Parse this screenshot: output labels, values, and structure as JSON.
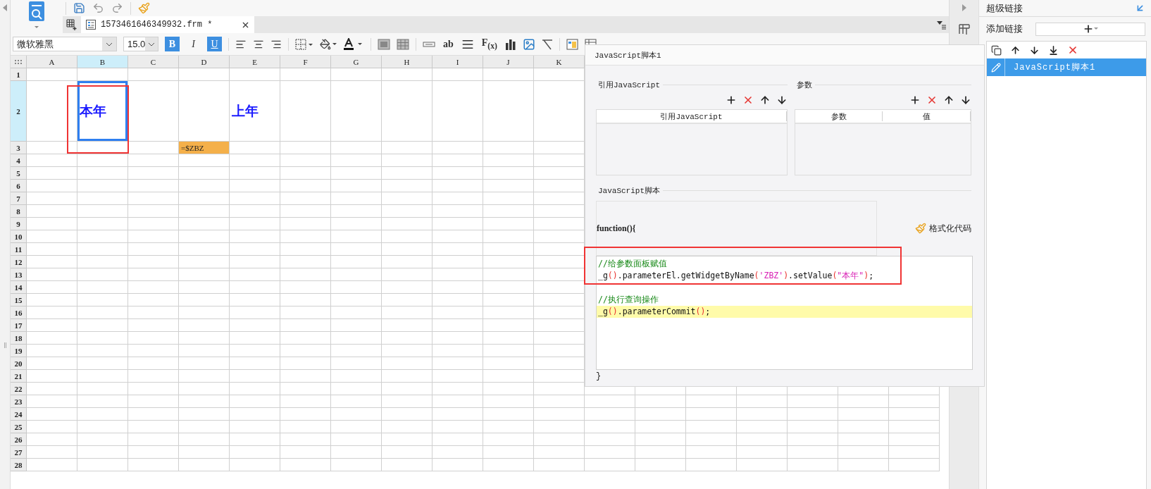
{
  "file_tab": {
    "title": "1573461646349932.frm *",
    "selected": true
  },
  "format_bar": {
    "font": "微软雅黑",
    "size": "15.0",
    "bold": {
      "label": "B",
      "on": true
    },
    "italic": {
      "label": "I",
      "on": false
    },
    "underline": {
      "label": "U",
      "on": true
    },
    "text_tools": [
      "ab",
      "F$_{(x)}$"
    ]
  },
  "sheet": {
    "columns": [
      {
        "label": "A",
        "selected": false
      },
      {
        "label": "B",
        "selected": true
      },
      {
        "label": "C",
        "selected": false
      },
      {
        "label": "D",
        "selected": false
      },
      {
        "label": "E",
        "selected": false
      },
      {
        "label": "F",
        "selected": false
      },
      {
        "label": "G",
        "selected": false
      },
      {
        "label": "H",
        "selected": false
      },
      {
        "label": "I",
        "selected": false
      },
      {
        "label": "J",
        "selected": false
      },
      {
        "label": "K",
        "selected": false
      }
    ],
    "rows": [
      {
        "label": "1",
        "selected": false
      },
      {
        "label": "2",
        "selected": true,
        "cells": [
          null,
          {
            "text": "本年",
            "kind": "title",
            "selected": true
          },
          null,
          null,
          {
            "text": "上年",
            "kind": "title",
            "selected": false
          }
        ]
      },
      {
        "label": "3",
        "selected": false,
        "cells": [
          null,
          null,
          null,
          {
            "text": "=$ZBZ",
            "kind": "formula",
            "selected": false
          }
        ]
      },
      {
        "label": "4",
        "selected": false
      },
      {
        "label": "5",
        "selected": false
      },
      {
        "label": "6",
        "selected": false
      },
      {
        "label": "7",
        "selected": false
      },
      {
        "label": "8",
        "selected": false
      },
      {
        "label": "9",
        "selected": false
      },
      {
        "label": "10",
        "selected": false
      },
      {
        "label": "11",
        "selected": false
      },
      {
        "label": "12",
        "selected": false
      },
      {
        "label": "13",
        "selected": false
      },
      {
        "label": "14",
        "selected": false
      },
      {
        "label": "15",
        "selected": false
      },
      {
        "label": "16",
        "selected": false
      },
      {
        "label": "17",
        "selected": false
      },
      {
        "label": "18",
        "selected": false
      },
      {
        "label": "19",
        "selected": false
      },
      {
        "label": "20",
        "selected": false
      },
      {
        "label": "21",
        "selected": false
      },
      {
        "label": "22",
        "selected": false
      },
      {
        "label": "23",
        "selected": false
      },
      {
        "label": "24",
        "selected": false
      },
      {
        "label": "25",
        "selected": false
      },
      {
        "label": "26",
        "selected": false
      },
      {
        "label": "27",
        "selected": false
      },
      {
        "label": "28",
        "selected": false
      }
    ]
  },
  "dialog": {
    "title": "JavaScript脚本1",
    "imports": {
      "legend": "引用JavaScript",
      "columns": [
        "引用JavaScript"
      ]
    },
    "params": {
      "legend": "参数",
      "columns": [
        "参数",
        "值"
      ]
    },
    "script": {
      "legend": "JavaScript脚本",
      "header": "function(){",
      "format_button": "格式化代码",
      "footer": "}",
      "lines": [
        {
          "kind": "comment",
          "text": "//给参数面板赋值",
          "highlighted": false
        },
        {
          "kind": "code",
          "highlighted": false,
          "tokens": [
            {
              "kind": "plain",
              "text": "_g"
            },
            {
              "kind": "paren",
              "text": "()"
            },
            {
              "kind": "plain",
              "text": ".parameterEl.getWidgetByName"
            },
            {
              "kind": "paren",
              "text": "("
            },
            {
              "kind": "string",
              "text": "'ZBZ'"
            },
            {
              "kind": "paren",
              "text": ")"
            },
            {
              "kind": "plain",
              "text": ".setValue"
            },
            {
              "kind": "paren",
              "text": "("
            },
            {
              "kind": "string",
              "text": "\"本年\""
            },
            {
              "kind": "paren",
              "text": ")"
            },
            {
              "kind": "plain",
              "text": ";"
            }
          ]
        },
        {
          "kind": "blank",
          "highlighted": false
        },
        {
          "kind": "comment",
          "text": "//执行查询操作",
          "highlighted": false
        },
        {
          "kind": "code",
          "highlighted": true,
          "tokens": [
            {
              "kind": "plain",
              "text": "_g"
            },
            {
              "kind": "paren",
              "text": "()"
            },
            {
              "kind": "plain",
              "text": ".parameterCommit"
            },
            {
              "kind": "paren",
              "text": "()"
            },
            {
              "kind": "plain",
              "text": ";"
            }
          ]
        }
      ]
    }
  },
  "hyperlink_panel": {
    "title": "超级链接",
    "add_label": "添加链接",
    "items": [
      {
        "label": "JavaScript脚本1",
        "selected": true
      }
    ]
  }
}
